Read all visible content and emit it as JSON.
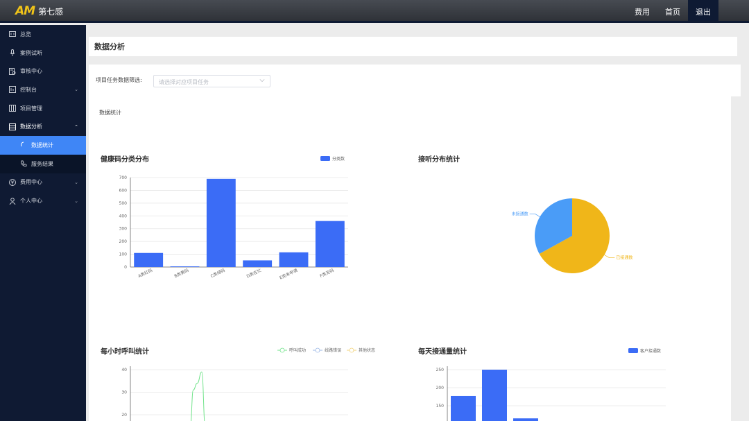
{
  "app": {
    "logo_mark": "AM",
    "logo_text": "第七感"
  },
  "topnav": {
    "fees": "费用",
    "home": "首页",
    "logout": "退出"
  },
  "sidebar": {
    "items": [
      {
        "label": "总览",
        "icon": "dashboard-icon"
      },
      {
        "label": "案例试听",
        "icon": "microphone-icon"
      },
      {
        "label": "审核中心",
        "icon": "audit-icon"
      },
      {
        "label": "控制台",
        "icon": "console-icon"
      },
      {
        "label": "项目管理",
        "icon": "project-icon"
      },
      {
        "label": "数据分析",
        "icon": "analysis-icon"
      },
      {
        "label": "费用中心",
        "icon": "yen-icon"
      },
      {
        "label": "个人中心",
        "icon": "user-icon"
      }
    ],
    "sub_items": [
      {
        "label": "数据统计",
        "icon": "loading-icon"
      },
      {
        "label": "服务结果",
        "icon": "phone-icon"
      }
    ]
  },
  "page": {
    "title": "数据分析",
    "filter_label": "项目任务数据筛选:",
    "filter_placeholder": "请选择对应项目任务",
    "section_title": "数据统计"
  },
  "colors": {
    "accent": "#3f86f6",
    "bar": "#3b6cf6",
    "pie_yellow": "#f0b619",
    "pie_blue": "#4a9cf7",
    "line_green": "#71e38a",
    "sidebar_bg": "#0f1a33"
  },
  "chart_data": [
    {
      "type": "bar",
      "title": "健康码分类分布",
      "legend": [
        "分类数"
      ],
      "categories": [
        "A类红码",
        "B类黄码",
        "C类绿码",
        "D类在忙",
        "E类未申请",
        "F类无码"
      ],
      "values": [
        110,
        5,
        690,
        52,
        115,
        360
      ],
      "ylim": [
        0,
        700
      ],
      "yticks": [
        "0",
        "100",
        "200",
        "300",
        "400",
        "500",
        "600",
        "700"
      ]
    },
    {
      "type": "pie",
      "title": "接听分布统计",
      "labels": [
        "未接通数",
        "已接通数"
      ],
      "values": [
        33,
        67
      ]
    },
    {
      "type": "line",
      "title": "每小时呼叫统计",
      "legend": [
        "呼叫成功",
        "线路错误",
        "其他状态"
      ],
      "yticks": [
        "20",
        "30",
        "40"
      ],
      "ylim": [
        20,
        40
      ],
      "series": [
        {
          "name": "呼叫成功",
          "points": [
            [
              6,
              0
            ],
            [
              6.3,
              31
            ],
            [
              6.7,
              34
            ],
            [
              7.15,
              39
            ],
            [
              7.5,
              0
            ]
          ]
        }
      ]
    },
    {
      "type": "bar",
      "title": "每天接通量统计",
      "legend": [
        "客户接通数"
      ],
      "values": [
        177,
        250,
        115
      ],
      "yticks": [
        "150",
        "200",
        "250"
      ],
      "ylim": [
        150,
        250
      ]
    }
  ]
}
